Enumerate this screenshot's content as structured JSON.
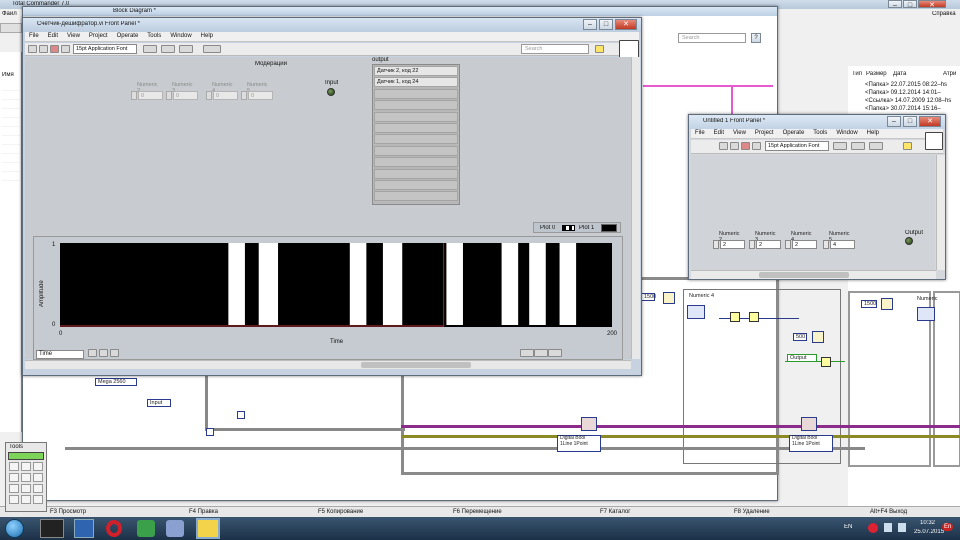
{
  "tc": {
    "title": "Total Commander 7.0",
    "menu_label": "Файл",
    "header_left": "Имя",
    "header_right": [
      "Тип",
      "Размер",
      "Дата",
      "Атри"
    ],
    "top_right": "Справка",
    "rows": [
      [
        "<Папка>",
        "22.07.2015 08:22–hs"
      ],
      [
        "<Папка>",
        "09.12.2014 14:01–"
      ],
      [
        "<Ссылка>",
        "14.07.2009 12:08–hs"
      ],
      [
        "<Папка>",
        "30.07.2014 15:16–"
      ]
    ],
    "fkeys": [
      "F3 Просмотр",
      "F4 Правка",
      "F5 Копирование",
      "F6 Перемещение",
      "F7 Каталог",
      "F8 Удаление",
      "Alt+F4 Выход"
    ]
  },
  "block_diagram": {
    "title": "Block Diagram *",
    "search": "Search",
    "nodes": {
      "mega": "Mega 2560",
      "input": "Input",
      "numeric4": "Numeric 4",
      "n1500a": "1500",
      "n1500b": "1500",
      "n500": "500",
      "output": "Output",
      "dbool1": "Digital Bool 1Line 1Point",
      "dbool2": "Digital Bool 1Line 1Point",
      "numeric_cut": "Numeric"
    }
  },
  "main_panel": {
    "title": "Счетчик-дешифратор.vi Front Panel *",
    "menu": [
      "File",
      "Edit",
      "View",
      "Project",
      "Operate",
      "Tools",
      "Window",
      "Help"
    ],
    "font_select": "15pt Application Font",
    "search": "Search",
    "moderations_label": "Модерации",
    "numerics": [
      {
        "label": "Numeric 2",
        "value": "0"
      },
      {
        "label": "Numeric 3",
        "value": "0"
      },
      {
        "label": "Numeric 4",
        "value": "0"
      },
      {
        "label": "Numeric 5",
        "value": "0"
      }
    ],
    "input_label": "Input",
    "output_label": "output",
    "output_items": [
      "Датчик 2, код 22",
      "Датчик 1, код 24",
      "",
      "",
      "",
      "",
      "",
      "",
      "",
      "",
      "",
      ""
    ],
    "legend": {
      "plot0": "Plot 0",
      "plot1": "Plot 1"
    },
    "graph": {
      "ylabel": "Amplitude",
      "xlabel": "Time",
      "y_ticks": [
        "1",
        "0"
      ],
      "x_ticks": [
        "0",
        "200"
      ],
      "time_label": "Time"
    }
  },
  "untitled_panel": {
    "title": "Untitled 1 Front Panel *",
    "menu": [
      "File",
      "Edit",
      "View",
      "Project",
      "Operate",
      "Tools",
      "Window",
      "Help"
    ],
    "font_select": "15pt Application Font",
    "numerics": [
      {
        "label": "Numeric 2",
        "value": "2"
      },
      {
        "label": "Numeric 3",
        "value": "2"
      },
      {
        "label": "Numeric 4",
        "value": "2"
      },
      {
        "label": "Numeric 5",
        "value": "4"
      }
    ],
    "output_label": "Output"
  },
  "tools_palette": {
    "title": "Tools"
  },
  "taskbar": {
    "lang": "EN",
    "time": "10:32",
    "date": "25.07.2015",
    "lang_badge": "En"
  },
  "chart_data": {
    "type": "line",
    "series": [
      {
        "name": "Plot 0",
        "pulses": [
          [
            61,
            67
          ],
          [
            72,
            79
          ],
          [
            105,
            111
          ],
          [
            117,
            124
          ],
          [
            140,
            146
          ],
          [
            160,
            166
          ],
          [
            170,
            176
          ],
          [
            181,
            187
          ],
          [
            205,
            211
          ]
        ]
      }
    ],
    "xlim": [
      0,
      200
    ],
    "ylim": [
      0,
      1
    ],
    "xlabel": "Time",
    "ylabel": "Amplitude"
  }
}
